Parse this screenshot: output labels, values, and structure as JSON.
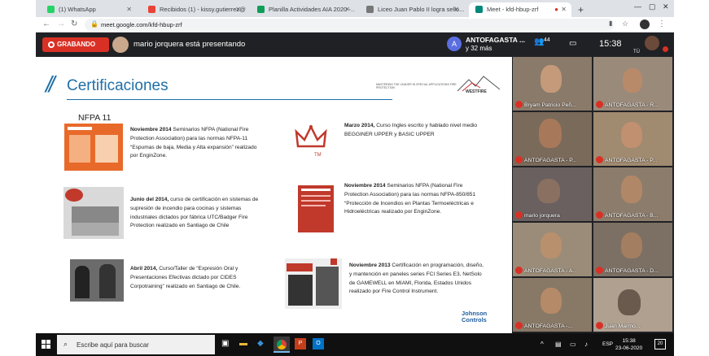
{
  "browser": {
    "tabs": [
      {
        "label": "(1) WhatsApp",
        "color": "#25d366"
      },
      {
        "label": "Recibidos (1) - kissy.gutierrez@...",
        "color": "#ea4335"
      },
      {
        "label": "Planilla Actividades AIA 2020 -...",
        "color": "#0f9d58"
      },
      {
        "label": "Liceo Juan Pablo II logra sello...",
        "color": "#777777"
      },
      {
        "label": "Meet - kfd-hbup-zrf",
        "color": "#00897b"
      }
    ],
    "new_tab": "+",
    "url": "meet.google.com/kfd-hbup-zrf"
  },
  "meet": {
    "recording_label": "GRABANDO",
    "presenter_text": "mario jorquera está presentando",
    "group_initial": "A",
    "group_name": "ANTOFAGASTA ...",
    "group_more": "y 32 más",
    "people_count": "44",
    "time": "15:38",
    "self_label": "TÚ"
  },
  "slide": {
    "slashes": "//",
    "title": "Certificaciones",
    "nfpa_label": "NFPA 11",
    "westfire_tagline": "MASTERING THE LEADER IN SPECIAL APPLICATIONS FIRE PROTECTION",
    "westfire_logo": "WESTFIRE",
    "johnson_logo_line1": "Johnson",
    "johnson_logo_line2": "Controls",
    "certs": [
      {
        "date": "Noviembre 2014",
        "text": " Seminarios NFPA (National Fire Protection Association) para las normas NFPA-11 “Espumas de baja, Media y Alta expansión” realizado por EnginZone."
      },
      {
        "date": "Junio del 2014,",
        "text": " curso de certificación en sistemas de supresión de incendio para cocinas y sistemas industriales dictados por fábrica UTC/Badger Fire Protection realizado en Santiago de Chile"
      },
      {
        "date": "Abril 2014,",
        "text": " Curso/Taller de “Expresión Oral y Presentaciones Efectivas dictado por CIDES Corpotraining” realizado en Santiago de Chile."
      },
      {
        "date": "Marzo 2014,",
        "text": "  Curso Ingles escrito y hablado nivel medio BEGGINER UPPER  y BASIC UPPER"
      },
      {
        "date": "Noviembre 2014",
        "text": " Seminarios NFPA (National Fire Protection Association) para las normas NFPA-850/851 “Protección de Incendios en Plantas Termoeléctricas e Hidroeléctricas realizado por EnginZone."
      },
      {
        "date": "Noviembre 2013",
        "text": " Certificación en programación, diseño, y mantención en paneles series FCI Series E3, NetSolo de  GAMEWELL en MIAMI, Florida, Estados Unidos realizado por Fire Control Instrument."
      }
    ]
  },
  "participants": [
    {
      "name": "Bryam Patricio Peñ...",
      "bg": "#8a7a6a"
    },
    {
      "name": "ANTOFAGASTA - R...",
      "bg": "#9a8a7a"
    },
    {
      "name": "ANTOFAGASTA - P...",
      "bg": "#7a6a5a"
    },
    {
      "name": "ANTOFAGASTA - P...",
      "bg": "#a08a70"
    },
    {
      "name": "mario jorquera",
      "bg": "#6a6060"
    },
    {
      "name": "ANTOFAGASTA - B...",
      "bg": "#8c7c6c"
    },
    {
      "name": "ANTOFAGASTA - A...",
      "bg": "#9a8c78"
    },
    {
      "name": "ANTOFAGASTA - D...",
      "bg": "#7c7064"
    },
    {
      "name": "ANTOFAGASTA -...",
      "bg": "#887866"
    },
    {
      "name": "Juan Marmo...",
      "bg": "#b0a090"
    }
  ],
  "taskbar": {
    "search_placeholder": "Escribe aquí para buscar",
    "lang": "ESP",
    "time": "15:38",
    "date": "23-06-2020",
    "notifications": "20"
  }
}
